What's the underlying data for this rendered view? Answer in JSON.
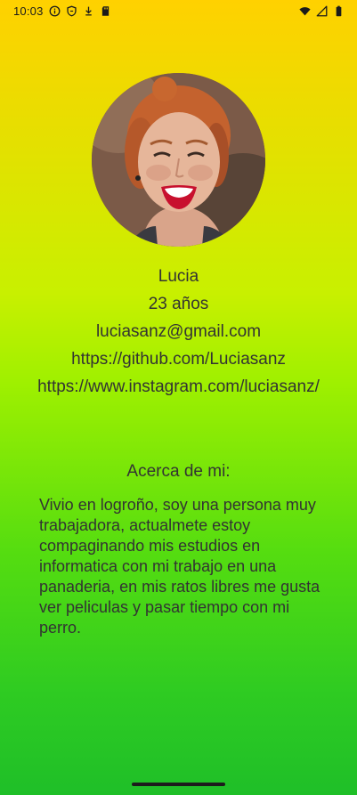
{
  "status_bar": {
    "time": "10:03",
    "left_icons": [
      "info-icon",
      "shield-icon",
      "download-icon",
      "sd-card-icon"
    ],
    "right_icons": [
      "wifi-icon",
      "signal-icon",
      "battery-icon"
    ]
  },
  "profile": {
    "avatar_icon": "profile-photo",
    "name": "Lucia",
    "age": "23 años",
    "email": "luciasanz@gmail.com",
    "github": "https://github.com/Luciasanz",
    "instagram": "https://www.instagram.com/luciasanz/"
  },
  "about": {
    "heading": "Acerca de mi:",
    "text": "Vivio en logroño, soy una persona muy trabajadora, actualmete estoy compaginando mis estudios en informatica con mi trabajo en una panaderia, en mis ratos libres me gusta ver peliculas y pasar tiempo con mi perro."
  },
  "colors": {
    "gradient_top": "#ffd100",
    "gradient_mid": "#9ff000",
    "gradient_bottom": "#1fbf28",
    "text": "#333333"
  }
}
